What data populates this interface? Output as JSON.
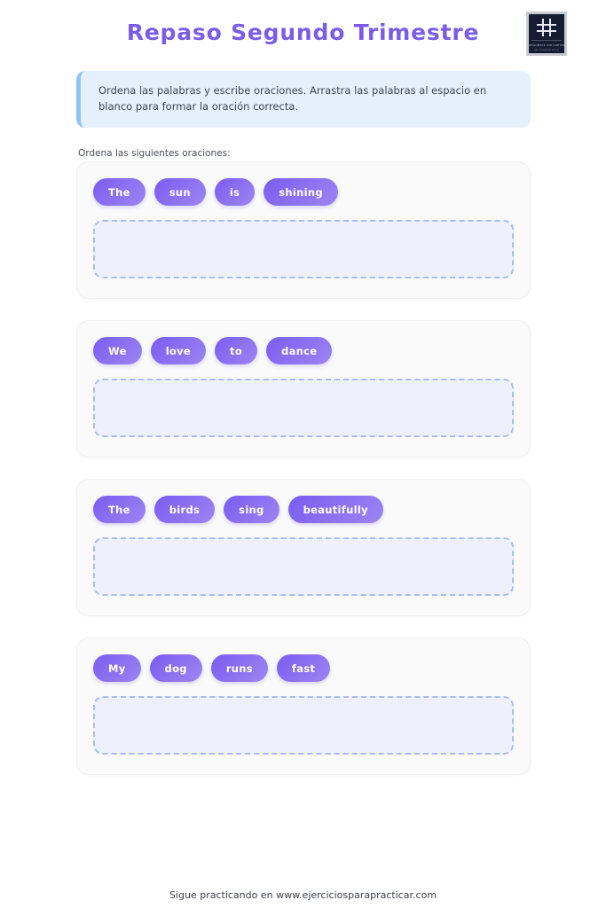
{
  "header": {
    "title": "Repaso Segundo Trimestre",
    "title_color": "#7b5ce8",
    "logo": {
      "mark_name": "hash-grid-icon",
      "line1": "PREGUNTAS SIN LIMITES",
      "line2": "ejerciciosparapracticar"
    }
  },
  "instructions": {
    "text": "Ordena las palabras y escribe oraciones. Arrastra las palabras al espacio en blanco para formar la oración correcta.",
    "accent_color": "#8ec5f0",
    "background_color": "#e4f1fc"
  },
  "section": {
    "label": "Ordena las siguientes oraciones:"
  },
  "exercises": [
    {
      "id": "exercise-1",
      "words": [
        "The",
        "sun",
        "is",
        "shining"
      ],
      "answer_value": "",
      "answer_placeholder": ""
    },
    {
      "id": "exercise-2",
      "words": [
        "We",
        "love",
        "to",
        "dance"
      ],
      "answer_value": "",
      "answer_placeholder": ""
    },
    {
      "id": "exercise-3",
      "words": [
        "The",
        "birds",
        "sing",
        "beautifully"
      ],
      "answer_value": "",
      "answer_placeholder": ""
    },
    {
      "id": "exercise-4",
      "words": [
        "My",
        "dog",
        "runs",
        "fast"
      ],
      "answer_value": "",
      "answer_placeholder": ""
    }
  ],
  "footer": {
    "text": "Sigue practicando en www.ejerciciosparapracticar.com"
  },
  "theme": {
    "pill_gradient_start": "#7a5cf0",
    "pill_gradient_end": "#9d85f2",
    "card_background": "#fafafa",
    "dropzone_border": "#aabdf2",
    "dropzone_background": "#eef1fc"
  }
}
